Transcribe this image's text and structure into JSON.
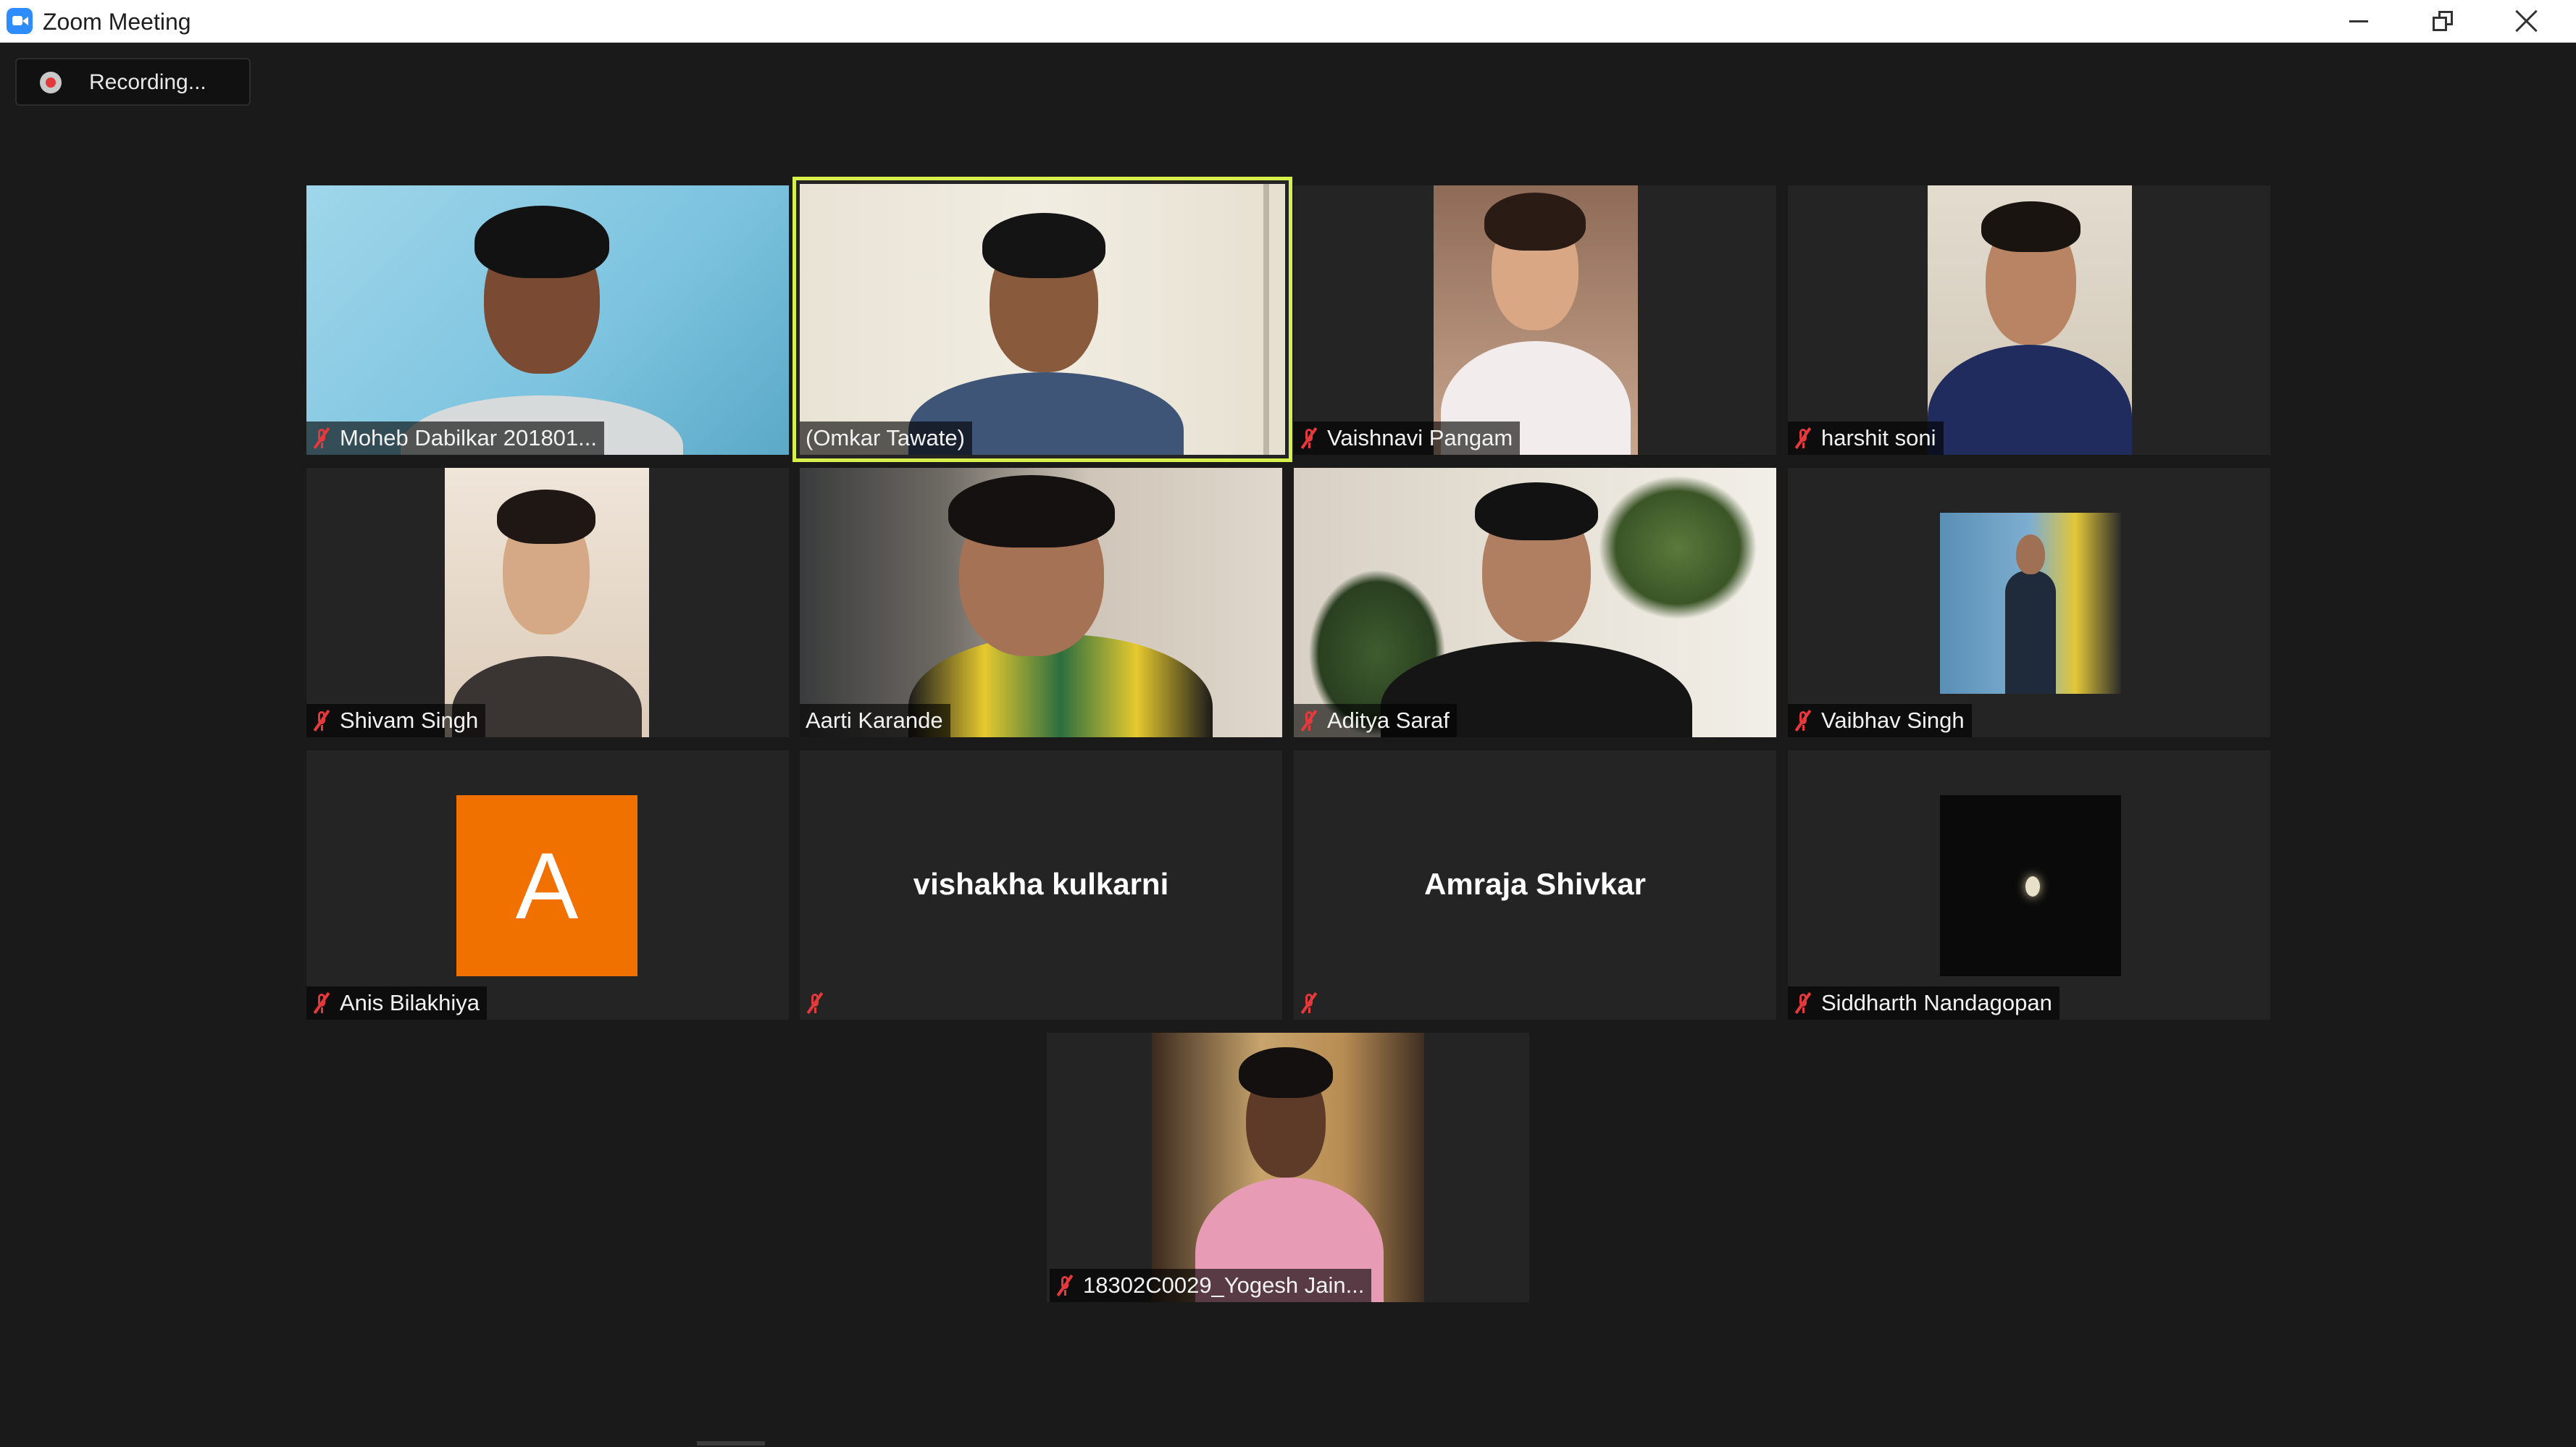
{
  "window": {
    "title": "Zoom Meeting",
    "controls": [
      "minimize",
      "restore",
      "close"
    ]
  },
  "recording": {
    "label": "Recording..."
  },
  "colors": {
    "active_speaker_border": "#d7f04c",
    "muted_icon": "#e5393b",
    "avatar_bg": "#f07100",
    "background": "#1a1a1a",
    "tile_bg": "#242424"
  },
  "participants": [
    {
      "name": "Moheb Dabilkar 201801...",
      "muted": true,
      "video": true
    },
    {
      "name": "(Omkar Tawate)",
      "muted": false,
      "video": true,
      "active_speaker": true
    },
    {
      "name": "Vaishnavi Pangam",
      "muted": true,
      "video": true
    },
    {
      "name": "harshit soni",
      "muted": true,
      "video": true
    },
    {
      "name": "Shivam Singh",
      "muted": true,
      "video": true
    },
    {
      "name": "Aarti Karande",
      "muted": false,
      "video": true
    },
    {
      "name": "Aditya Saraf",
      "muted": true,
      "video": true
    },
    {
      "name": "Vaibhav Singh",
      "muted": true,
      "video": true
    },
    {
      "name": "Anis Bilakhiya",
      "muted": true,
      "video": false,
      "avatar_letter": "A"
    },
    {
      "name": "vishakha kulkarni",
      "muted": true,
      "video": false
    },
    {
      "name": "Amraja Shivkar",
      "muted": true,
      "video": false
    },
    {
      "name": "Siddharth Nandagopan",
      "muted": true,
      "video": true
    },
    {
      "name": "18302C0029_Yogesh Jain...",
      "muted": true,
      "video": true
    }
  ]
}
